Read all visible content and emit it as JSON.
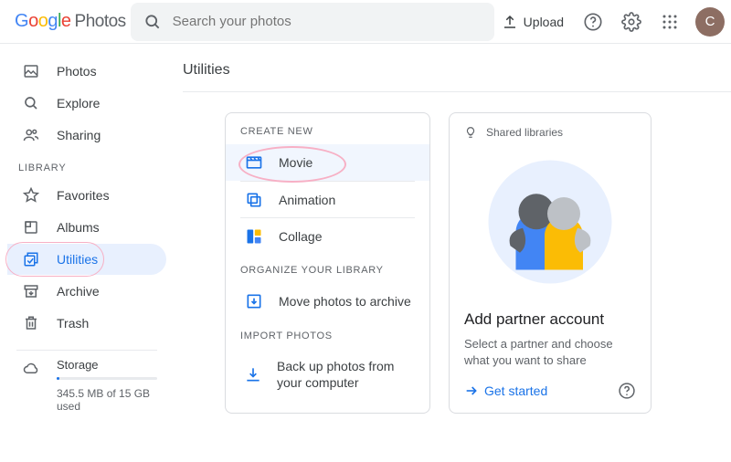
{
  "header": {
    "logo": {
      "google": [
        "G",
        "o",
        "o",
        "g",
        "l",
        "e"
      ],
      "photos": "Photos"
    },
    "search_placeholder": "Search your photos",
    "upload_label": "Upload",
    "avatar_initial": "C"
  },
  "sidebar": {
    "items": [
      {
        "icon": "image-icon",
        "label": "Photos"
      },
      {
        "icon": "search-icon",
        "label": "Explore"
      },
      {
        "icon": "people-icon",
        "label": "Sharing"
      }
    ],
    "library_label": "LIBRARY",
    "library_items": [
      {
        "icon": "star-icon",
        "label": "Favorites"
      },
      {
        "icon": "album-icon",
        "label": "Albums"
      },
      {
        "icon": "utilities-icon",
        "label": "Utilities",
        "active": true
      },
      {
        "icon": "archive-icon",
        "label": "Archive"
      },
      {
        "icon": "trash-icon",
        "label": "Trash"
      }
    ],
    "storage": {
      "label": "Storage",
      "detail": "345.5 MB of 15 GB used"
    }
  },
  "main": {
    "title": "Utilities",
    "create_heading": "CREATE NEW",
    "create_items": [
      {
        "icon": "movie-icon",
        "label": "Movie",
        "selected": true
      },
      {
        "icon": "animation-icon",
        "label": "Animation"
      },
      {
        "icon": "collage-icon",
        "label": "Collage"
      }
    ],
    "organize_heading": "ORGANIZE YOUR LIBRARY",
    "organize_item": {
      "icon": "archive-down-icon",
      "label": "Move photos to archive"
    },
    "import_heading": "IMPORT PHOTOS",
    "import_item": {
      "icon": "download-icon",
      "label": "Back up photos from your computer"
    },
    "partner": {
      "hint": "Shared libraries",
      "title": "Add partner account",
      "subtitle": "Select a partner and choose what you want to share",
      "cta": "Get started"
    }
  }
}
